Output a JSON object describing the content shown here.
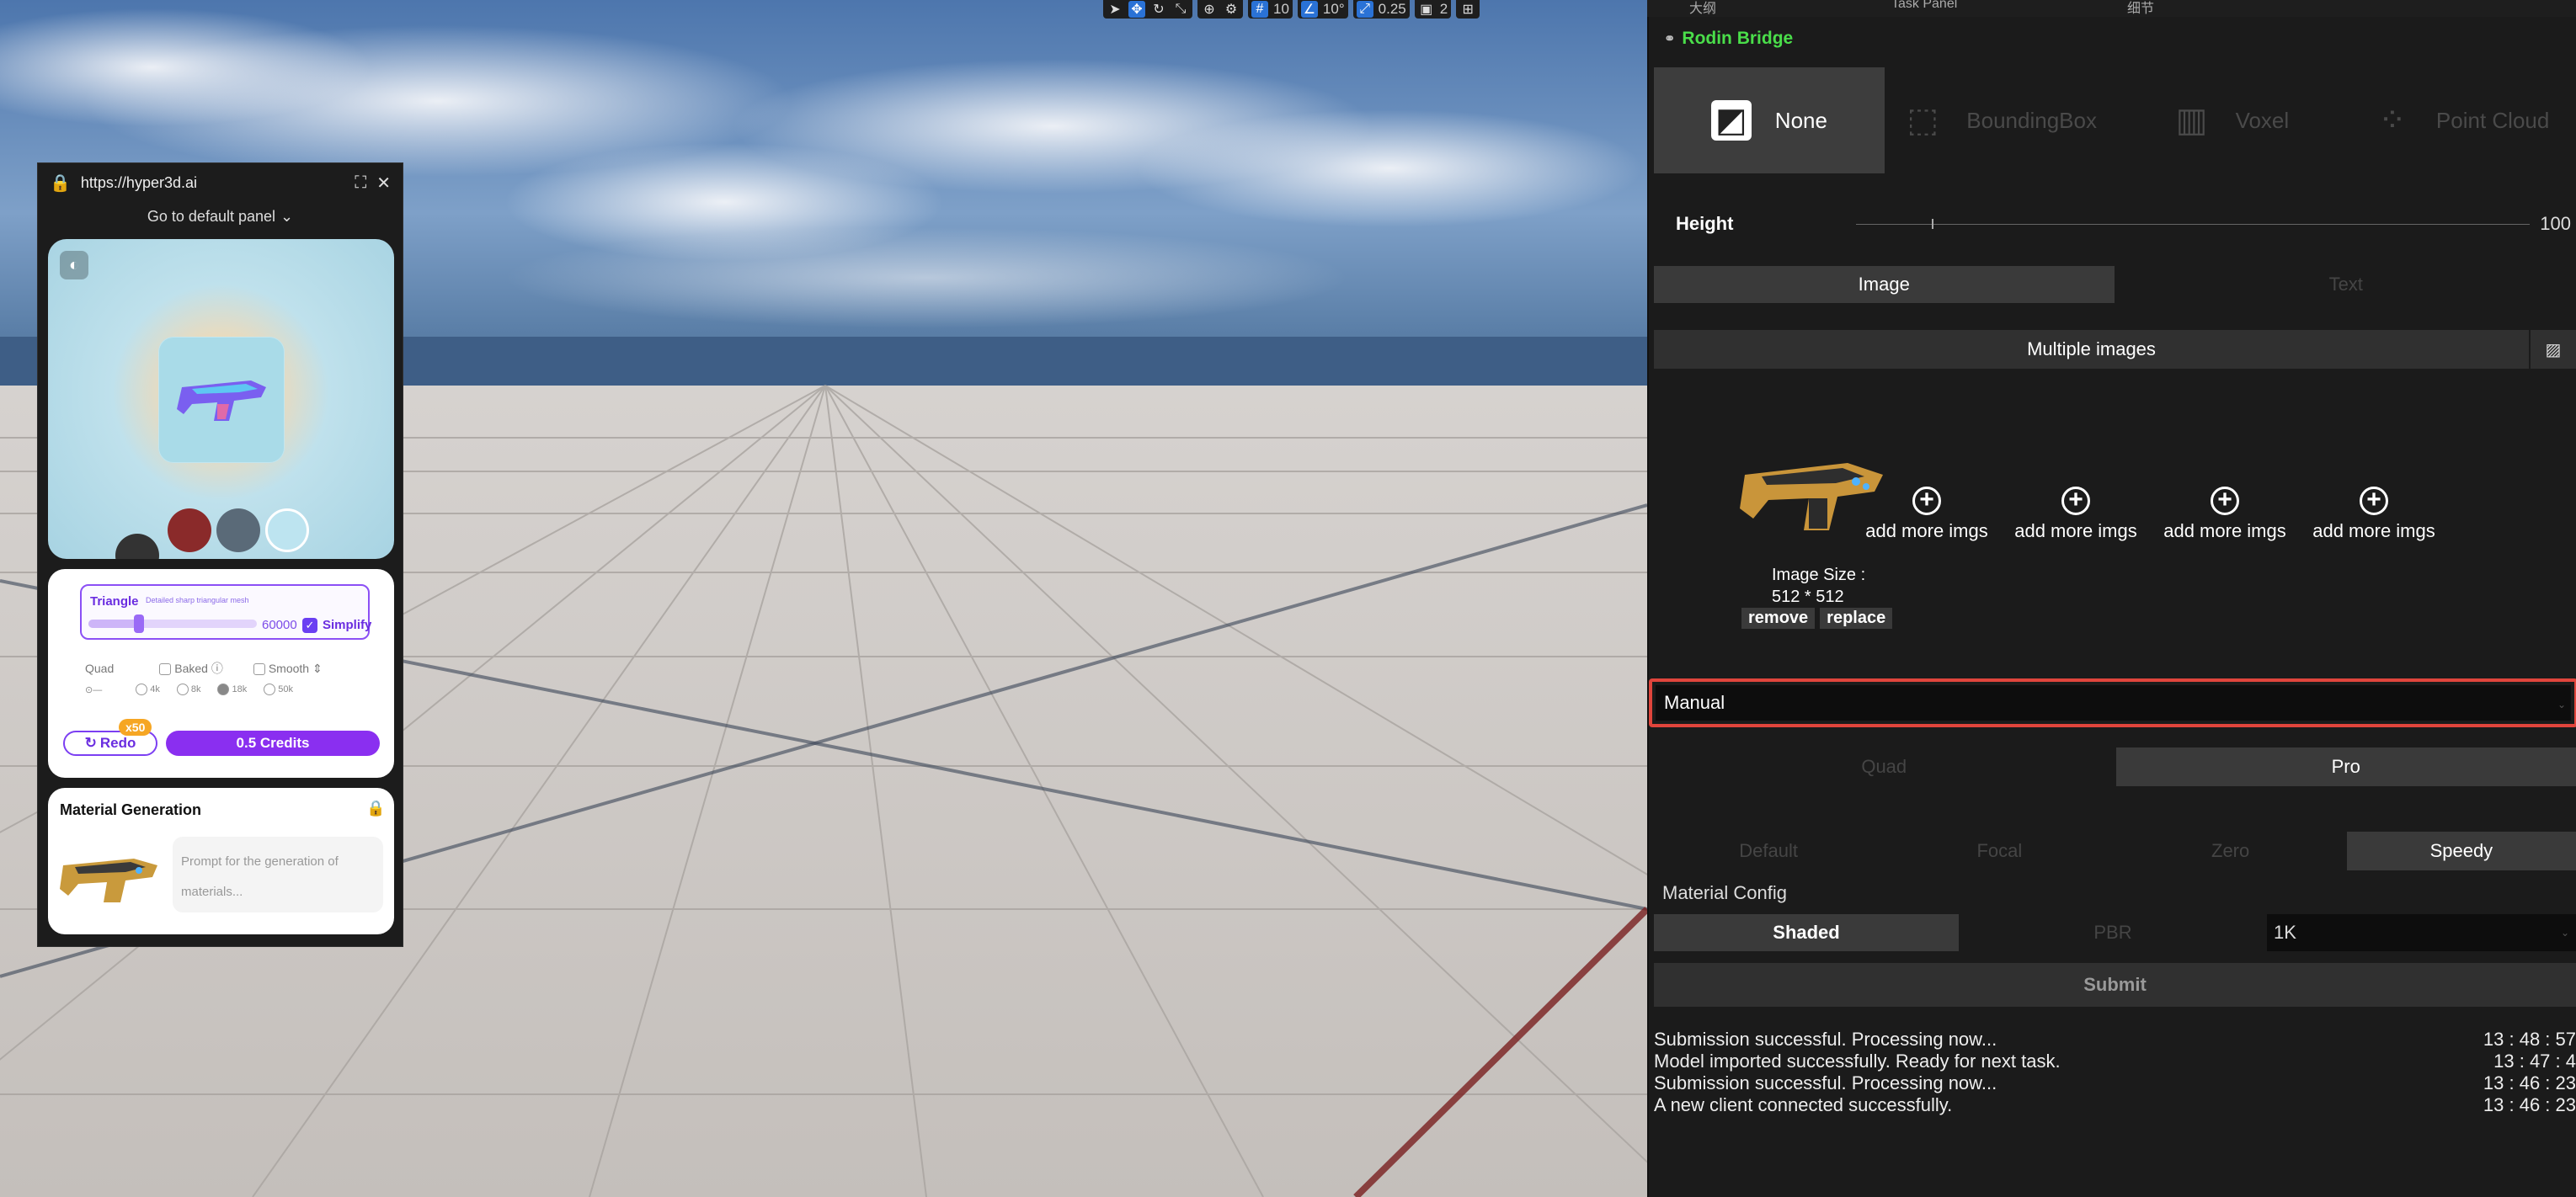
{
  "viewport": {
    "toolbar": {
      "grid_value": "10",
      "angle_value": "10°",
      "scale_value": "0.25",
      "camera_value": "2"
    }
  },
  "web_panel": {
    "url": "https://hyper3d.ai",
    "goto_label": "Go to default panel",
    "triangle": {
      "label": "Triangle",
      "description": "Detailed sharp triangular mesh",
      "value": "60000",
      "simplify_label": "Simplify"
    },
    "options": {
      "quad_label": "Quad",
      "baked_label": "Baked",
      "smooth_label": "Smooth"
    },
    "resolutions": [
      "4k",
      "8k",
      "18k",
      "50k"
    ],
    "redo_label": "Redo",
    "redo_badge": "x50",
    "credits_label": "0.5 Credits",
    "material": {
      "title": "Material Generation",
      "prompt_placeholder": "Prompt for the generation of materials..."
    }
  },
  "right_panel": {
    "tabs": [
      "大纲",
      "Task Panel",
      "细节"
    ],
    "title": "Rodin Bridge",
    "modes": [
      {
        "label": "None",
        "icon": "image-icon",
        "selected": true
      },
      {
        "label": "BoundingBox",
        "icon": "cube-icon",
        "selected": false
      },
      {
        "label": "Voxel",
        "icon": "voxel-icon",
        "selected": false
      },
      {
        "label": "Point Cloud",
        "icon": "point-cloud-icon",
        "selected": false
      }
    ],
    "height": {
      "label": "Height",
      "value": "100"
    },
    "input_type": {
      "image": "Image",
      "text": "Text",
      "selected": "Image"
    },
    "multiple_images_label": "Multiple images",
    "image": {
      "size_label": "Image Size :",
      "size_value": "512 * 512",
      "remove_label": "remove",
      "replace_label": "replace"
    },
    "add_more_label": "add more imgs",
    "generation_mode": "Manual",
    "topology": {
      "quad": "Quad",
      "pro": "Pro",
      "selected": "Pro"
    },
    "quality": {
      "options": [
        "Default",
        "Focal",
        "Zero",
        "Speedy"
      ],
      "selected": "Speedy"
    },
    "material_config": {
      "label": "Material Config",
      "shaded": "Shaded",
      "pbr": "PBR",
      "resolution": "1K",
      "selected": "Shaded"
    },
    "submit_label": "Submit",
    "log": [
      {
        "message": "Submission successful. Processing now...",
        "time": "13 : 48 : 57"
      },
      {
        "message": "Model imported successfully. Ready for next task.",
        "time": "13 : 47 : 4"
      },
      {
        "message": "Submission successful. Processing now...",
        "time": "13 : 46 : 23"
      },
      {
        "message": "A new client connected successfully.",
        "time": "13 : 46 : 23"
      }
    ]
  }
}
